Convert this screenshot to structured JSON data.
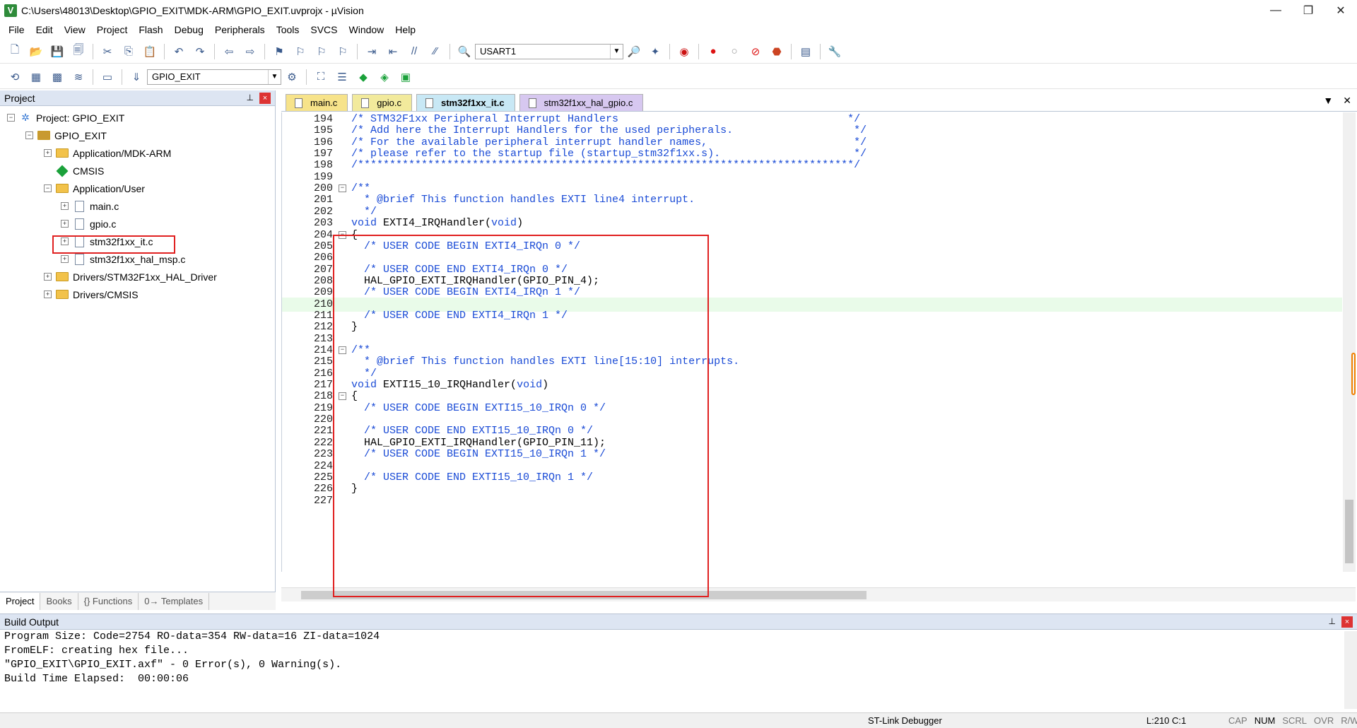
{
  "window": {
    "title": "C:\\Users\\48013\\Desktop\\GPIO_EXIT\\MDK-ARM\\GPIO_EXIT.uvprojx - µVision",
    "app_icon_letter": "V",
    "min_icon": "—",
    "max_icon": "❐",
    "close_icon": "✕"
  },
  "menu": [
    "File",
    "Edit",
    "View",
    "Project",
    "Flash",
    "Debug",
    "Peripherals",
    "Tools",
    "SVCS",
    "Window",
    "Help"
  ],
  "toolbar": {
    "target_combo": "USART1",
    "project_combo": "GPIO_EXIT"
  },
  "project_pane": {
    "title": "Project",
    "pin": "⊥",
    "close": "×",
    "tree": [
      {
        "label": "Project: GPIO_EXIT",
        "level": 0,
        "toggle": "−",
        "icon": "project-icon"
      },
      {
        "label": "GPIO_EXIT",
        "level": 1,
        "toggle": "−",
        "icon": "target-icon"
      },
      {
        "label": "Application/MDK-ARM",
        "level": 2,
        "toggle": "+",
        "icon": "folder-icon"
      },
      {
        "label": "CMSIS",
        "level": 2,
        "toggle": "",
        "icon": "diamond-icon"
      },
      {
        "label": "Application/User",
        "level": 2,
        "toggle": "−",
        "icon": "folder-icon"
      },
      {
        "label": "main.c",
        "level": 3,
        "toggle": "+",
        "icon": "file-icon"
      },
      {
        "label": "gpio.c",
        "level": 3,
        "toggle": "+",
        "icon": "file-icon"
      },
      {
        "label": "stm32f1xx_it.c",
        "level": 3,
        "toggle": "+",
        "icon": "file-icon"
      },
      {
        "label": "stm32f1xx_hal_msp.c",
        "level": 3,
        "toggle": "+",
        "icon": "file-icon"
      },
      {
        "label": "Drivers/STM32F1xx_HAL_Driver",
        "level": 2,
        "toggle": "+",
        "icon": "folder-icon"
      },
      {
        "label": "Drivers/CMSIS",
        "level": 2,
        "toggle": "+",
        "icon": "folder-icon"
      }
    ],
    "bottom_tabs": [
      "Project",
      "Books",
      "{} Functions",
      "0→ Templates"
    ]
  },
  "editor": {
    "tabs": [
      "main.c",
      "gpio.c",
      "stm32f1xx_it.c",
      "stm32f1xx_hal_gpio.c"
    ],
    "active_tab": "stm32f1xx_it.c",
    "tab_menu_icon": "▼",
    "tab_close_icon": "✕",
    "lines": [
      {
        "n": "194",
        "fold": "",
        "text": "/* STM32F1xx Peripheral Interrupt Handlers                                    */"
      },
      {
        "n": "195",
        "fold": "",
        "text": "/* Add here the Interrupt Handlers for the used peripherals.                   */"
      },
      {
        "n": "196",
        "fold": "",
        "text": "/* For the available peripheral interrupt handler names,                       */"
      },
      {
        "n": "197",
        "fold": "",
        "text": "/* please refer to the startup file (startup_stm32f1xx.s).                     */"
      },
      {
        "n": "198",
        "fold": "",
        "text": "/******************************************************************************/"
      },
      {
        "n": "199",
        "fold": "",
        "text": ""
      },
      {
        "n": "200",
        "fold": "−",
        "text": "/**"
      },
      {
        "n": "201",
        "fold": "",
        "text": "  * @brief This function handles EXTI line4 interrupt."
      },
      {
        "n": "202",
        "fold": "",
        "text": "  */"
      },
      {
        "n": "203",
        "fold": "",
        "text": "void EXTI4_IRQHandler(void)"
      },
      {
        "n": "204",
        "fold": "−",
        "text": "{"
      },
      {
        "n": "205",
        "fold": "",
        "text": "  /* USER CODE BEGIN EXTI4_IRQn 0 */"
      },
      {
        "n": "206",
        "fold": "",
        "text": ""
      },
      {
        "n": "207",
        "fold": "",
        "text": "  /* USER CODE END EXTI4_IRQn 0 */"
      },
      {
        "n": "208",
        "fold": "",
        "text": "  HAL_GPIO_EXTI_IRQHandler(GPIO_PIN_4);"
      },
      {
        "n": "209",
        "fold": "",
        "text": "  /* USER CODE BEGIN EXTI4_IRQn 1 */"
      },
      {
        "n": "210",
        "fold": "",
        "text": ""
      },
      {
        "n": "211",
        "fold": "",
        "text": "  /* USER CODE END EXTI4_IRQn 1 */"
      },
      {
        "n": "212",
        "fold": "",
        "text": "}"
      },
      {
        "n": "213",
        "fold": "",
        "text": ""
      },
      {
        "n": "214",
        "fold": "−",
        "text": "/**"
      },
      {
        "n": "215",
        "fold": "",
        "text": "  * @brief This function handles EXTI line[15:10] interrupts."
      },
      {
        "n": "216",
        "fold": "",
        "text": "  */"
      },
      {
        "n": "217",
        "fold": "",
        "text": "void EXTI15_10_IRQHandler(void)"
      },
      {
        "n": "218",
        "fold": "−",
        "text": "{"
      },
      {
        "n": "219",
        "fold": "",
        "text": "  /* USER CODE BEGIN EXTI15_10_IRQn 0 */"
      },
      {
        "n": "220",
        "fold": "",
        "text": ""
      },
      {
        "n": "221",
        "fold": "",
        "text": "  /* USER CODE END EXTI15_10_IRQn 0 */"
      },
      {
        "n": "222",
        "fold": "",
        "text": "  HAL_GPIO_EXTI_IRQHandler(GPIO_PIN_11);"
      },
      {
        "n": "223",
        "fold": "",
        "text": "  /* USER CODE BEGIN EXTI15_10_IRQn 1 */"
      },
      {
        "n": "224",
        "fold": "",
        "text": ""
      },
      {
        "n": "225",
        "fold": "",
        "text": "  /* USER CODE END EXTI15_10_IRQn 1 */"
      },
      {
        "n": "226",
        "fold": "",
        "text": "}"
      },
      {
        "n": "227",
        "fold": "",
        "text": ""
      }
    ],
    "current_line": "210"
  },
  "build_output": {
    "title": "Build Output",
    "lines": [
      "Program Size: Code=2754 RO-data=354 RW-data=16 ZI-data=1024",
      "FromELF: creating hex file...",
      "\"GPIO_EXIT\\GPIO_EXIT.axf\" - 0 Error(s), 0 Warning(s).",
      "Build Time Elapsed:  00:00:06"
    ]
  },
  "status_bar": {
    "debugger": "ST-Link Debugger",
    "position": "L:210 C:1",
    "flags": [
      "CAP",
      "NUM",
      "SCRL",
      "OVR",
      "R/W"
    ],
    "active_flag": "NUM"
  },
  "colors": {
    "comment": "#1a4bd6",
    "highlight_box": "#e02020",
    "current_line": "#e9fbe9"
  }
}
